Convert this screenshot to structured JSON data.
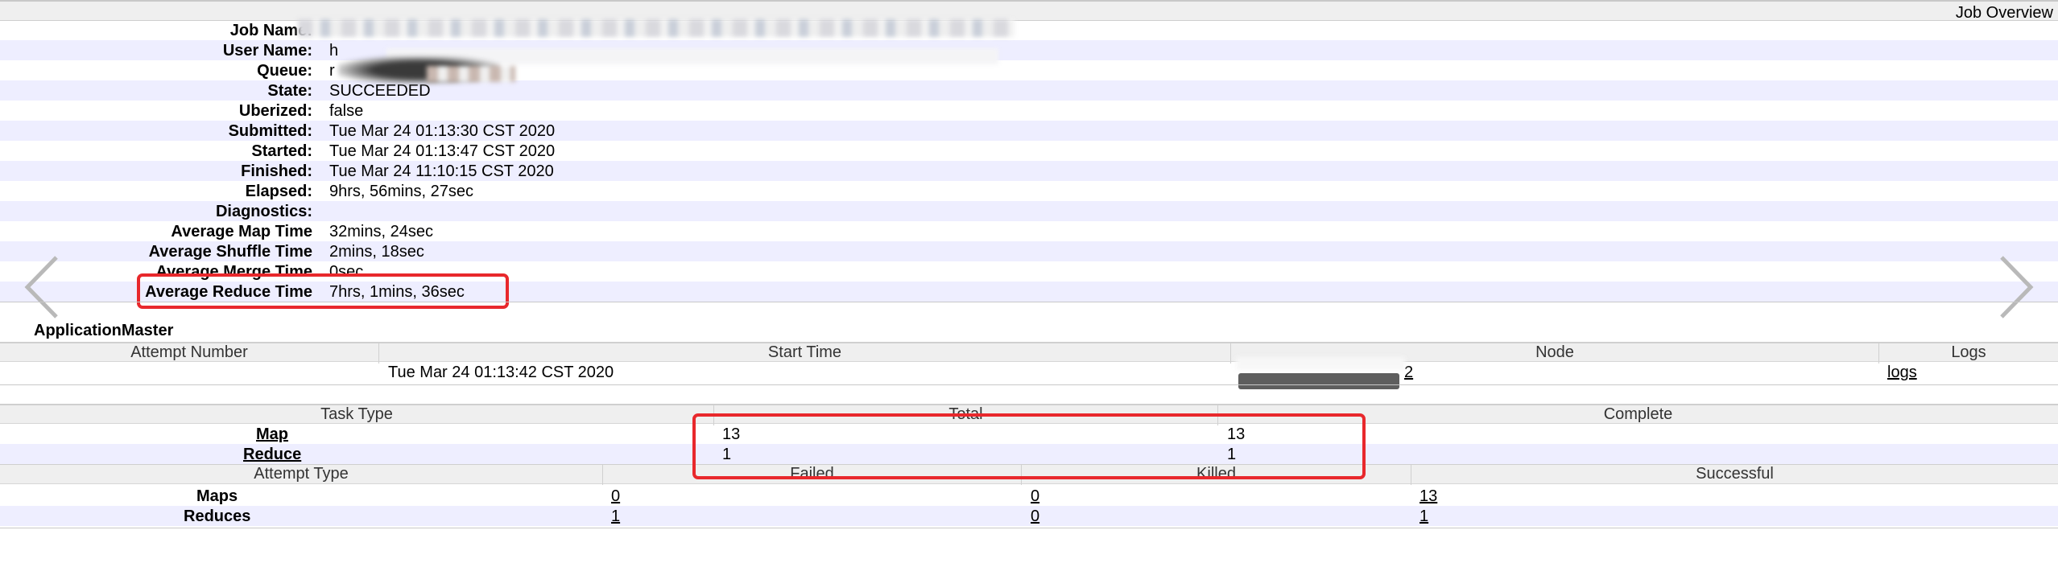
{
  "overview": {
    "title": "Job Overview",
    "rows": [
      {
        "label": "Job Name:",
        "value": ""
      },
      {
        "label": "User Name:",
        "value": "h"
      },
      {
        "label": "Queue:",
        "value": "r"
      },
      {
        "label": "State:",
        "value": "SUCCEEDED"
      },
      {
        "label": "Uberized:",
        "value": "false"
      },
      {
        "label": "Submitted:",
        "value": "Tue Mar 24 01:13:30 CST 2020"
      },
      {
        "label": "Started:",
        "value": "Tue Mar 24 01:13:47 CST 2020"
      },
      {
        "label": "Finished:",
        "value": "Tue Mar 24 11:10:15 CST 2020"
      },
      {
        "label": "Elapsed:",
        "value": "9hrs, 56mins, 27sec"
      },
      {
        "label": "Diagnostics:",
        "value": ""
      },
      {
        "label": "Average Map Time",
        "value": "32mins, 24sec"
      },
      {
        "label": "Average Shuffle Time",
        "value": "2mins, 18sec"
      },
      {
        "label": "Average Merge Time",
        "value": "0sec"
      },
      {
        "label": "Average Reduce Time",
        "value": "7hrs, 1mins, 36sec"
      }
    ]
  },
  "app_master": {
    "title": "ApplicationMaster",
    "columns": [
      "Attempt Number",
      "Start Time",
      "Node",
      "Logs"
    ],
    "row": {
      "attempt": "",
      "start_time": "Tue Mar 24 01:13:42 CST 2020",
      "node": "2",
      "logs": "logs"
    }
  },
  "tasks": {
    "columns": [
      "Task Type",
      "Total",
      "Complete"
    ],
    "rows": [
      {
        "type": "Map",
        "total": "13",
        "complete": "13"
      },
      {
        "type": "Reduce",
        "total": "1",
        "complete": "1"
      }
    ]
  },
  "attempts": {
    "columns": [
      "Attempt Type",
      "Failed",
      "Killed",
      "Successful"
    ],
    "rows": [
      {
        "type": "Maps",
        "failed": "0",
        "killed": "0",
        "successful": "13"
      },
      {
        "type": "Reduces",
        "failed": "1",
        "killed": "0",
        "successful": "1"
      }
    ]
  },
  "colors": {
    "highlight": "#e8282c",
    "row_alt": "#eeeeff",
    "header_bg": "#efefef"
  },
  "icons": {
    "prev": "chevron-left-icon",
    "next": "chevron-right-icon"
  }
}
